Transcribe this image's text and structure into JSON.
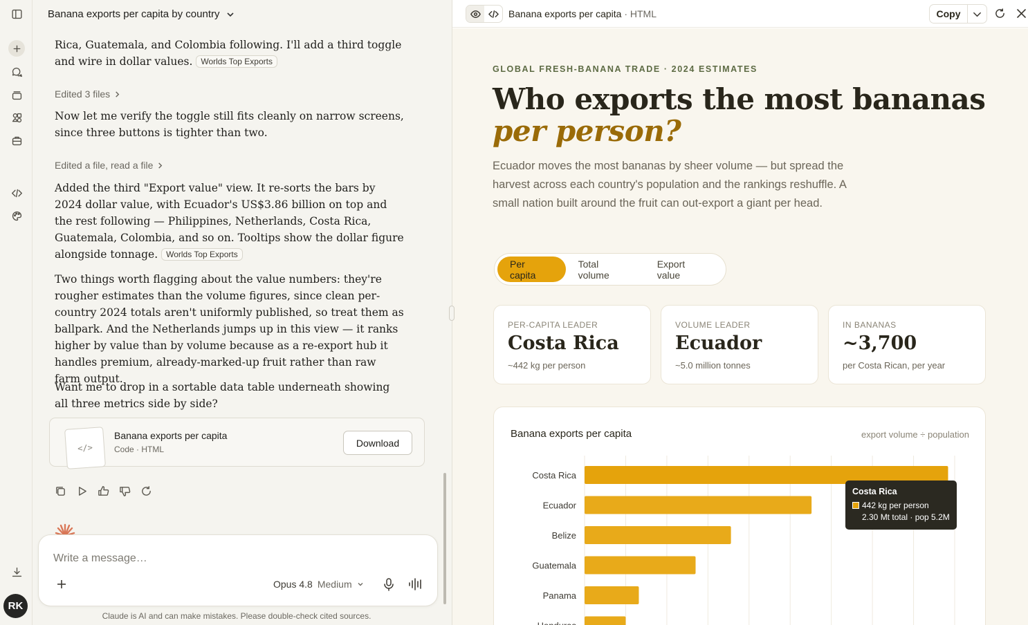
{
  "chat": {
    "title": "Banana exports per capita by country",
    "msg_top": "Rica, Guatemala, and Colombia following. I'll add a third toggle and wire in dollar values.",
    "msg_top_chip": "Worlds Top Exports",
    "edited1": "Edited 3 files",
    "msg2": "Now let me verify the toggle still fits cleanly on narrow screens, since three buttons is tighter than two.",
    "edited2": "Edited a file, read a file",
    "msg3": "Added the third \"Export value\" view. It re-sorts the bars by 2024 dollar value, with Ecuador's US$3.86 billion on top and the rest following — Philippines, Netherlands, Costa Rica, Guatemala, Colombia, and so on. Tooltips show the dollar figure alongside tonnage.",
    "msg3_chip": "Worlds Top Exports",
    "msg4": "Two things worth flagging about the value numbers: they're rougher estimates than the volume figures, since clean per-country 2024 totals aren't uniformly published, so treat them as ballpark. And the Netherlands jumps up in this view — it ranks higher by value than by volume because as a re-export hub it handles premium, already-marked-up fruit rather than raw farm output.",
    "msg5": "Want me to drop in a sortable data table underneath showing all three metrics side by side?",
    "artifact_name": "Banana exports per capita",
    "artifact_sub": "Code · HTML",
    "artifact_thumb": "</>",
    "download": "Download",
    "composer_placeholder": "Write a message…",
    "model": "Opus 4.8",
    "effort": "Medium",
    "disclaimer": "Claude is AI and can make mistakes. Please double-check cited sources."
  },
  "user": {
    "initials": "RK"
  },
  "panel": {
    "title": "Banana exports per capita",
    "title_suffix": " · HTML",
    "copy": "Copy"
  },
  "page": {
    "eyebrow": "GLOBAL FRESH-BANANA TRADE · 2024 ESTIMATES",
    "headline": "Who exports the most bananas",
    "headline_accent": "per person?",
    "lede": "Ecuador moves the most bananas by sheer volume — but spread the harvest across each country's population and the rankings reshuffle. A small nation built around the fruit can out-export a giant per head.",
    "tabs": [
      "Per capita",
      "Total volume",
      "Export value"
    ],
    "active_tab": "Per capita",
    "stats": [
      {
        "label": "PER-CAPITA LEADER",
        "value": "Costa Rica",
        "sub": "~442 kg per person"
      },
      {
        "label": "VOLUME LEADER",
        "value": "Ecuador",
        "sub": "~5.0 million tonnes"
      },
      {
        "label": "IN BANANAS",
        "value": "~3,700",
        "sub": "per Costa Rican, per year"
      }
    ],
    "accent": "#e5a30c"
  },
  "chart_data": {
    "type": "bar",
    "orientation": "horizontal",
    "title": "Banana exports per capita",
    "note": "export volume ÷ population",
    "categories": [
      "Costa Rica",
      "Ecuador",
      "Belize",
      "Guatemala",
      "Panama",
      "Honduras"
    ],
    "values": [
      442,
      276,
      178,
      135,
      66,
      50
    ],
    "unit": "kg per person",
    "xlim": [
      0,
      450
    ],
    "grid": true,
    "colors": {
      "highlight": "#e5a30c",
      "bar": "#e8aa1a"
    },
    "tooltip": {
      "name": "Costa Rica",
      "line1": "442 kg per person",
      "line2": "2.30 Mt total · pop 5.2M"
    }
  }
}
